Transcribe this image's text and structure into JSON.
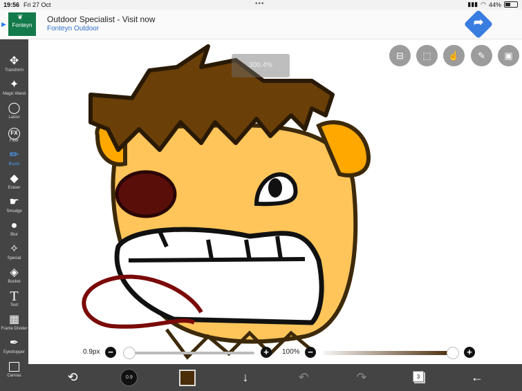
{
  "status": {
    "time": "19:56",
    "date": "Fri 27 Oct",
    "battery": "44%",
    "dots": "•••"
  },
  "ad": {
    "title": "Outdoor Specialist - Visit now",
    "subtitle": "Fonteyn Outdoor",
    "brand": "Fonteyn"
  },
  "toolbar": {
    "items": [
      {
        "label": "Transform",
        "icon": "✥"
      },
      {
        "label": "Magic Wand",
        "icon": "✦"
      },
      {
        "label": "Lasso",
        "icon": "◯"
      },
      {
        "label": "Filter",
        "icon": "FX"
      },
      {
        "label": "Brush",
        "icon": "✏"
      },
      {
        "label": "Eraser",
        "icon": "◆"
      },
      {
        "label": "Smudge",
        "icon": "☛"
      },
      {
        "label": "Blur",
        "icon": "💧"
      },
      {
        "label": "Special",
        "icon": "✧"
      },
      {
        "label": "Bucket",
        "icon": "◈"
      },
      {
        "label": "Text",
        "icon": "T"
      },
      {
        "label": "Frame Divider",
        "icon": "▦"
      },
      {
        "label": "Eyedropper",
        "icon": "✒"
      },
      {
        "label": "Canvas",
        "icon": "□"
      }
    ],
    "active_index": 4
  },
  "canvas": {
    "zoom": "300.4%"
  },
  "brush": {
    "size_label": "0.9px",
    "size_fraction": 0.0,
    "opacity_label": "100%",
    "opacity_fraction": 1.0,
    "size_badge": "0.9"
  },
  "colors": {
    "current": "#4b2d0a",
    "accent": "#4aa3ff",
    "toolbar_bg": "#444444"
  },
  "layers": {
    "count": "3"
  }
}
